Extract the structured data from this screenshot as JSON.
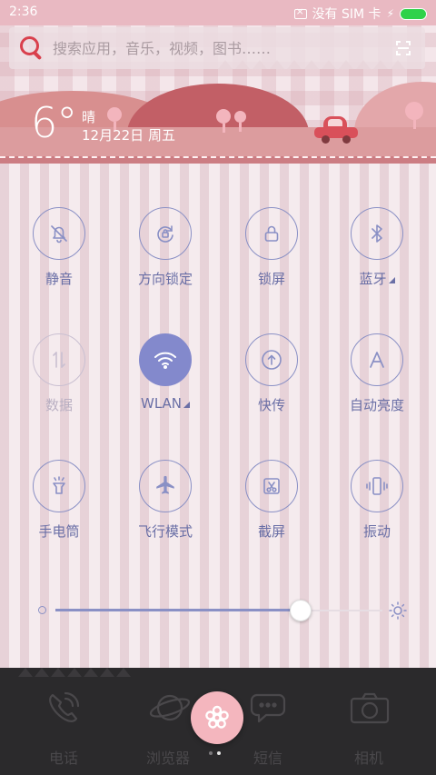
{
  "status_bar": {
    "time": "2:36",
    "no_sim_text": "没有 SIM 卡",
    "battery_color": "#2fd24a"
  },
  "search": {
    "placeholder": "搜索应用，音乐，视频，图书……",
    "search_icon": "search-icon",
    "scan_icon": "scan-icon"
  },
  "weather": {
    "temperature": "6°",
    "condition": "晴",
    "date": "12月22日 周五"
  },
  "toggles": [
    {
      "label": "静音",
      "icon": "mute-bell-icon",
      "state": "off"
    },
    {
      "label": "方向锁定",
      "icon": "rotation-lock-icon",
      "state": "off"
    },
    {
      "label": "锁屏",
      "icon": "lock-icon",
      "state": "off"
    },
    {
      "label": "蓝牙",
      "icon": "bluetooth-icon",
      "state": "off",
      "has_more": true
    },
    {
      "label": "数据",
      "icon": "data-arrows-icon",
      "state": "disabled"
    },
    {
      "label": "WLAN",
      "icon": "wifi-icon",
      "state": "on",
      "has_more": true
    },
    {
      "label": "快传",
      "icon": "quick-share-icon",
      "state": "off"
    },
    {
      "label": "自动亮度",
      "icon": "auto-brightness-icon",
      "state": "off"
    },
    {
      "label": "手电筒",
      "icon": "flashlight-icon",
      "state": "off"
    },
    {
      "label": "飞行模式",
      "icon": "airplane-icon",
      "state": "off"
    },
    {
      "label": "截屏",
      "icon": "screenshot-icon",
      "state": "off"
    },
    {
      "label": "振动",
      "icon": "vibrate-icon",
      "state": "off"
    }
  ],
  "brightness": {
    "level": 0.75,
    "min_icon": "brightness-low-icon",
    "max_icon": "brightness-high-icon"
  },
  "dock": {
    "apps": [
      {
        "label": "电话",
        "icon": "phone-icon"
      },
      {
        "label": "浏览器",
        "icon": "browser-planet-icon"
      },
      {
        "label": "短信",
        "icon": "message-icon"
      },
      {
        "label": "相机",
        "icon": "camera-icon"
      }
    ],
    "center_icon": "flower-icon",
    "pages": 2,
    "current_page": 2
  },
  "colors": {
    "accent": "#8389cc",
    "status_bar": "#e9b9c2",
    "search_icon": "#d9404d",
    "dock_bg": "#2b2a2c"
  }
}
